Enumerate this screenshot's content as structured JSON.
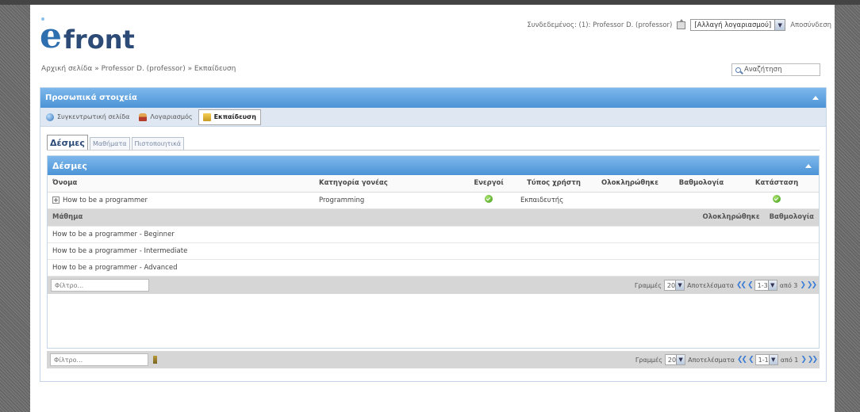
{
  "header": {
    "logo_e": "e",
    "logo_text": "front",
    "logged_in_text": "Συνδεδεμένος: (1): Professor D. (professor)",
    "account_select_value": "[Αλλαγή λογαριασμού]",
    "logout_label": "Αποσύνδεση",
    "breadcrumb": "Αρχική σελίδα » Professor D. (professor) » Εκπαίδευση",
    "search_label": "Αναζήτηση"
  },
  "panel": {
    "title": "Προσωπικά στοιχεία",
    "subtabs": [
      {
        "label": "Συγκεντρωτική σελίδα"
      },
      {
        "label": "Λογαριασμός"
      },
      {
        "label": "Εκπαίδευση"
      }
    ],
    "tabs": [
      {
        "label": "Δέσμες"
      },
      {
        "label": "Μαθήματα"
      },
      {
        "label": "Πιστοποιητικά"
      }
    ]
  },
  "bundles": {
    "title": "Δέσμες",
    "columns": [
      "Όνομα",
      "Κατηγορία γονέας",
      "Ενεργοί",
      "Τύπος χρήστη",
      "Ολοκληρώθηκε",
      "Βαθμολογία",
      "Κατάσταση"
    ],
    "row": {
      "name": "How to be a programmer",
      "category": "Programming",
      "user_type": "Εκπαιδευτής"
    },
    "lessons_header": {
      "name": "Μάθημα",
      "completed": "Ολοκληρώθηκε",
      "score": "Βαθμολογία"
    },
    "lessons": [
      "How to be a programmer - Beginner",
      "How to be a programmer - Intermediate",
      "How to be a programmer - Advanced"
    ],
    "inner_pager": {
      "filter_placeholder": "Φίλτρο...",
      "rows_label": "Γραμμές",
      "rows_value": "20",
      "results_label": "Αποτελέσματα",
      "range_value": "1-3",
      "of_total": "από 3"
    },
    "outer_pager": {
      "filter_placeholder": "Φίλτρο...",
      "rows_label": "Γραμμές",
      "rows_value": "20",
      "results_label": "Αποτελέσματα",
      "range_value": "1-1",
      "of_total": "από 1"
    }
  },
  "colors": {
    "bar_top": "#7db8ec",
    "bar_bottom": "#4c93d6",
    "logo_blue": "#2e6fb0",
    "check_green": "#3f9a1a"
  }
}
